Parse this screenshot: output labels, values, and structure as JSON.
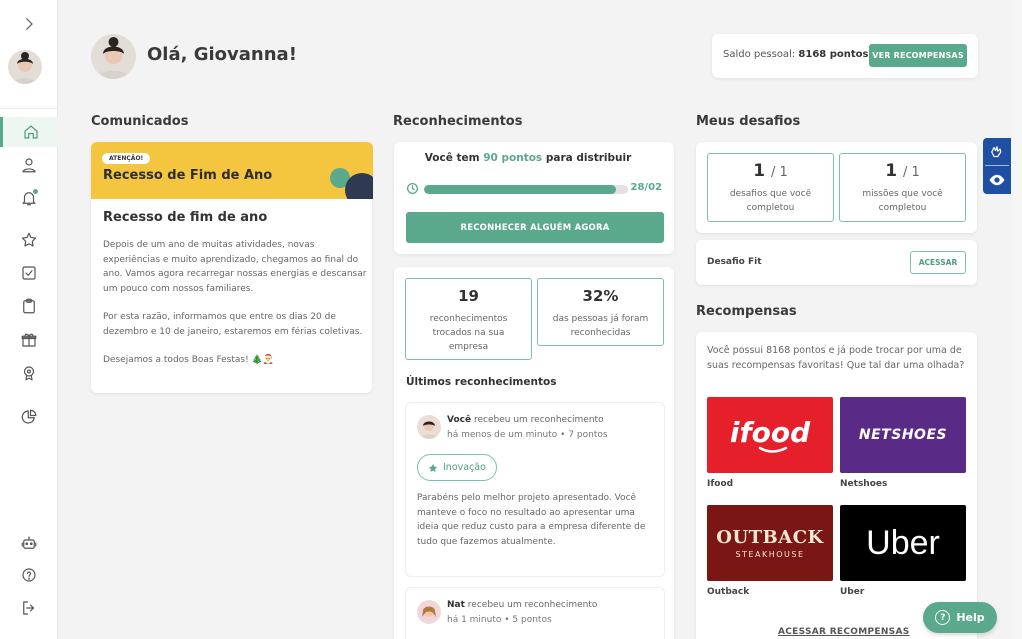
{
  "sidebar": {
    "expand_icon": "chevron-right-icon",
    "items": [
      {
        "name": "home",
        "icon": "home-icon",
        "active": true
      },
      {
        "name": "profile",
        "icon": "user-icon"
      },
      {
        "name": "notifications",
        "icon": "bell-icon"
      },
      {
        "name": "favorites",
        "icon": "star-icon"
      },
      {
        "name": "tasks",
        "icon": "checkbox-icon"
      },
      {
        "name": "clipboard",
        "icon": "clipboard-icon"
      },
      {
        "name": "gifts",
        "icon": "gift-icon"
      },
      {
        "name": "awards",
        "icon": "medal-icon"
      },
      {
        "name": "reports",
        "icon": "pie-chart-icon"
      },
      {
        "name": "bot",
        "icon": "robot-icon"
      },
      {
        "name": "help",
        "icon": "help-circle-icon"
      },
      {
        "name": "logout",
        "icon": "logout-icon"
      }
    ]
  },
  "header": {
    "greeting": "Olá, Giovanna!",
    "saldo_label": "Saldo pessoal:",
    "saldo_value": "8168 pontos",
    "ver_recompensas": "VER RECOMPENSAS"
  },
  "comunicados": {
    "title": "Comunicados",
    "banner_tag": "ATENÇÃO!",
    "banner_title": "Recesso de Fim de Ano",
    "heading": "Recesso de fim de ano",
    "paragraphs": [
      "Depois de um ano de muitas atividades, novas experiências e muito aprendizado, chegamos ao final do ano. Vamos agora recarregar nossas energias e descansar um pouco com nossos familiares.",
      "Por esta razão, informamos que entre os dias 20 de dezembro e 10 de janeiro, estaremos em férias coletivas.",
      "Desejamos a todos Boas Festas! 🎄🎅"
    ]
  },
  "reconhecimentos": {
    "title": "Reconhecimentos",
    "dist_prefix": "Você tem",
    "dist_points": "90 pontos",
    "dist_suffix": "para distribuir",
    "progress_label": "28/02",
    "progress_fraction": 0.94,
    "button": "RECONHECER ALGUÉM AGORA",
    "stats": [
      {
        "value": "19",
        "label": "reconhecimentos trocados na sua empresa"
      },
      {
        "value": "32%",
        "label": "das pessoas já foram reconhecidas"
      }
    ],
    "ultimos_title": "Últimos reconhecimentos",
    "feed": [
      {
        "who": "Você",
        "action": "recebeu um reconhecimento",
        "meta": "há menos de um minuto • 7 pontos",
        "chip": "Inovação",
        "message": "Parabéns pelo melhor projeto apresentado. Você manteve o foco no resultado ao apresentar uma ideia que reduz custo para a empresa diferente de tudo que fazemos atualmente."
      },
      {
        "who": "Nat",
        "action": "recebeu um reconhecimento",
        "meta": "há 1 minuto • 5 pontos"
      }
    ]
  },
  "desafios": {
    "title": "Meus desafios",
    "boxes": [
      {
        "done": "1",
        "total": "1",
        "label": "desafios que você completou"
      },
      {
        "done": "1",
        "total": "1",
        "label": "missões que você completou"
      }
    ],
    "item_label": "Desafio Fit",
    "item_button": "ACESSAR"
  },
  "recompensas": {
    "title": "Recompensas",
    "intro": "Você possui 8168 pontos e já pode trocar por uma de suas recompensas favoritas! Que tal dar uma olhada?",
    "items": [
      {
        "name": "Ifood",
        "logo_text": "ifood",
        "color": "#e5202a"
      },
      {
        "name": "Netshoes",
        "logo_text": "NETSHOES",
        "color": "#5a2a87"
      },
      {
        "name": "Outback",
        "logo_text": "OUTBACK",
        "logo_sub": "STEAKHOUSE",
        "color": "#7a1613"
      },
      {
        "name": "Uber",
        "logo_text": "Uber",
        "color": "#000000"
      }
    ],
    "link": "ACESSAR RECOMPENSAS"
  },
  "accessibility": {
    "icons": [
      "sign-language-icon",
      "eye-icon"
    ]
  },
  "help": {
    "label": "Help"
  },
  "colors": {
    "accent": "#5aa98c",
    "a11y": "#1f4fa3",
    "banner": "#f4c53f"
  }
}
